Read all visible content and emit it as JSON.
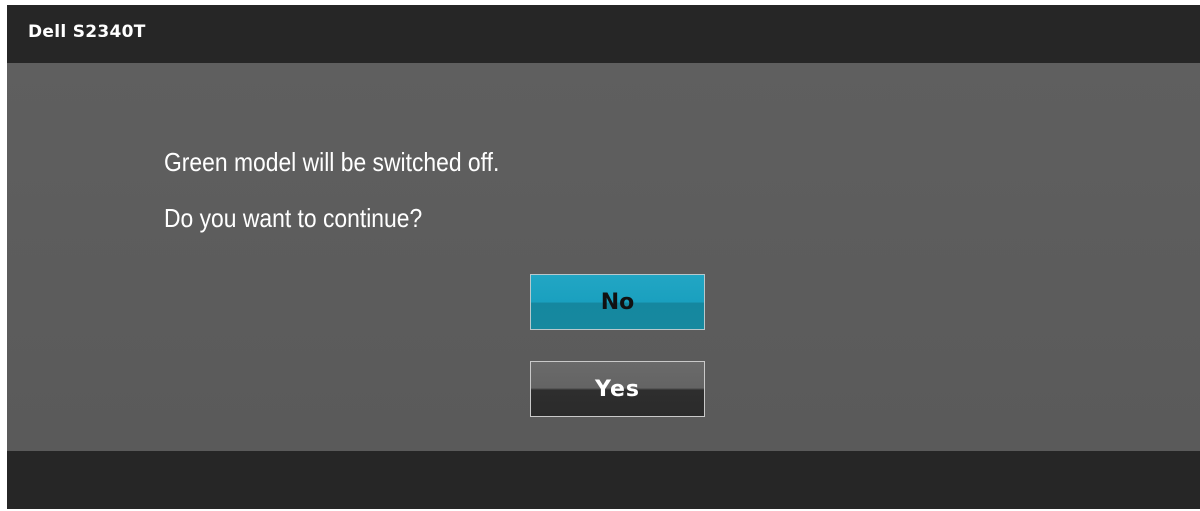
{
  "header": {
    "title": "Dell S2340T"
  },
  "dialog": {
    "message_line1": "Green model will be switched off.",
    "message_line2": "Do you want to continue?",
    "buttons": {
      "no_label": "No",
      "yes_label": "Yes",
      "selected": "No"
    }
  },
  "colors": {
    "title_bar": "#262626",
    "panel": "#5d5d5d",
    "selected_button": "#1aa0bf",
    "unselected_button": "#2e2e2e"
  }
}
